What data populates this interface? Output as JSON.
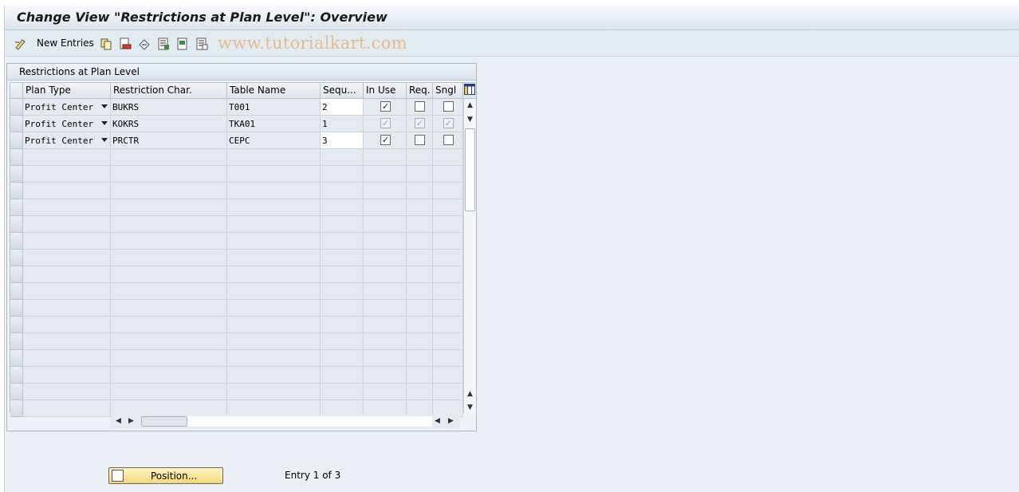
{
  "window": {
    "title": "Change View \"Restrictions at Plan Level\": Overview"
  },
  "toolbar": {
    "new_entries_label": "New Entries",
    "watermark": "www.tutorialkart.com",
    "icons": [
      "display-change-icon",
      "copy-icon",
      "delete-icon",
      "undo-icon",
      "select-all-icon",
      "select-block-icon",
      "deselect-all-icon"
    ]
  },
  "panel": {
    "title": "Restrictions at Plan Level"
  },
  "table": {
    "columns": [
      "Plan Type",
      "Restriction Char.",
      "Table Name",
      "Sequ...",
      "In Use",
      "Req.",
      "Sngl"
    ],
    "rows": [
      {
        "plan_type": "Profit Center",
        "restriction_char": "BUKRS",
        "table_name": "T001",
        "sequence": "2",
        "in_use": true,
        "req": false,
        "sngl": false,
        "editable": true
      },
      {
        "plan_type": "Profit Center",
        "restriction_char": "KOKRS",
        "table_name": "TKA01",
        "sequence": "1",
        "in_use": true,
        "req": true,
        "sngl": true,
        "editable": false
      },
      {
        "plan_type": "Profit Center",
        "restriction_char": "PRCTR",
        "table_name": "CEPC",
        "sequence": "3",
        "in_use": true,
        "req": false,
        "sngl": false,
        "editable": true
      }
    ],
    "empty_rows": 16
  },
  "footer": {
    "position_button_label": "Position...",
    "entry_info": "Entry 1 of 3"
  },
  "colors": {
    "accent": "#f5d777",
    "background": "#e9eff5",
    "watermark": "#e8b98a"
  }
}
